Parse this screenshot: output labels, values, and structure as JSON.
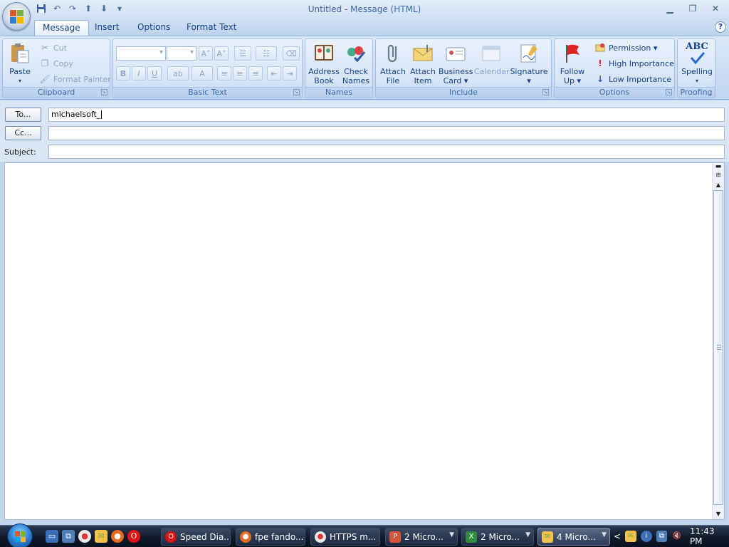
{
  "window": {
    "title": "Untitled - Message (HTML)",
    "minimize": "▁",
    "restore": "❐",
    "close": "✕"
  },
  "qat": {
    "customize": "▾"
  },
  "tabs": [
    {
      "label": "Message"
    },
    {
      "label": "Insert"
    },
    {
      "label": "Options"
    },
    {
      "label": "Format Text"
    }
  ],
  "help": "?",
  "ribbon": {
    "clipboard": {
      "label": "Clipboard",
      "paste": "Paste",
      "cut": "Cut",
      "copy": "Copy",
      "format_painter": "Format Painter"
    },
    "basic_text": {
      "label": "Basic Text",
      "bold": "B",
      "italic": "I",
      "underline": "U",
      "grow_font": "A˄",
      "shrink_font": "A˅",
      "font_color": "A"
    },
    "names": {
      "label": "Names",
      "address_book": "Address\nBook",
      "address_book_1": "Address",
      "address_book_2": "Book",
      "check_names_1": "Check",
      "check_names_2": "Names"
    },
    "include": {
      "label": "Include",
      "attach_file_1": "Attach",
      "attach_file_2": "File",
      "attach_item_1": "Attach",
      "attach_item_2": "Item",
      "business_card_1": "Business",
      "business_card_2": "Card ▾",
      "calendar": "Calendar",
      "signature_1": "Signature",
      "signature_2": "▾"
    },
    "options": {
      "label": "Options",
      "follow_up_1": "Follow",
      "follow_up_2": "Up ▾",
      "permission": "Permission ▾",
      "high_importance": "High Importance",
      "low_importance": "Low Importance"
    },
    "proofing": {
      "label": "Proofing",
      "spelling": "Spelling",
      "spelling_arrow": "▾",
      "abc": "ABC"
    }
  },
  "header": {
    "to_button": "To...",
    "to_value": "michaelsoft_",
    "cc_button": "Cc...",
    "cc_value": "",
    "subject_label": "Subject:",
    "subject_value": ""
  },
  "taskbar": {
    "tasks": [
      {
        "label": "Speed Dia..."
      },
      {
        "label": "fpe fando..."
      },
      {
        "label": "HTTPS m..."
      },
      {
        "label": "2 Micro..."
      },
      {
        "label": "2 Micro..."
      },
      {
        "label": "4 Micro..."
      }
    ],
    "tray_chevron": "<",
    "clock": "11:43 PM"
  },
  "colors": {
    "ribbon_text": "#15428b",
    "accent_blue": "#8db2e3",
    "taskbar_dark": "#101a2c"
  }
}
